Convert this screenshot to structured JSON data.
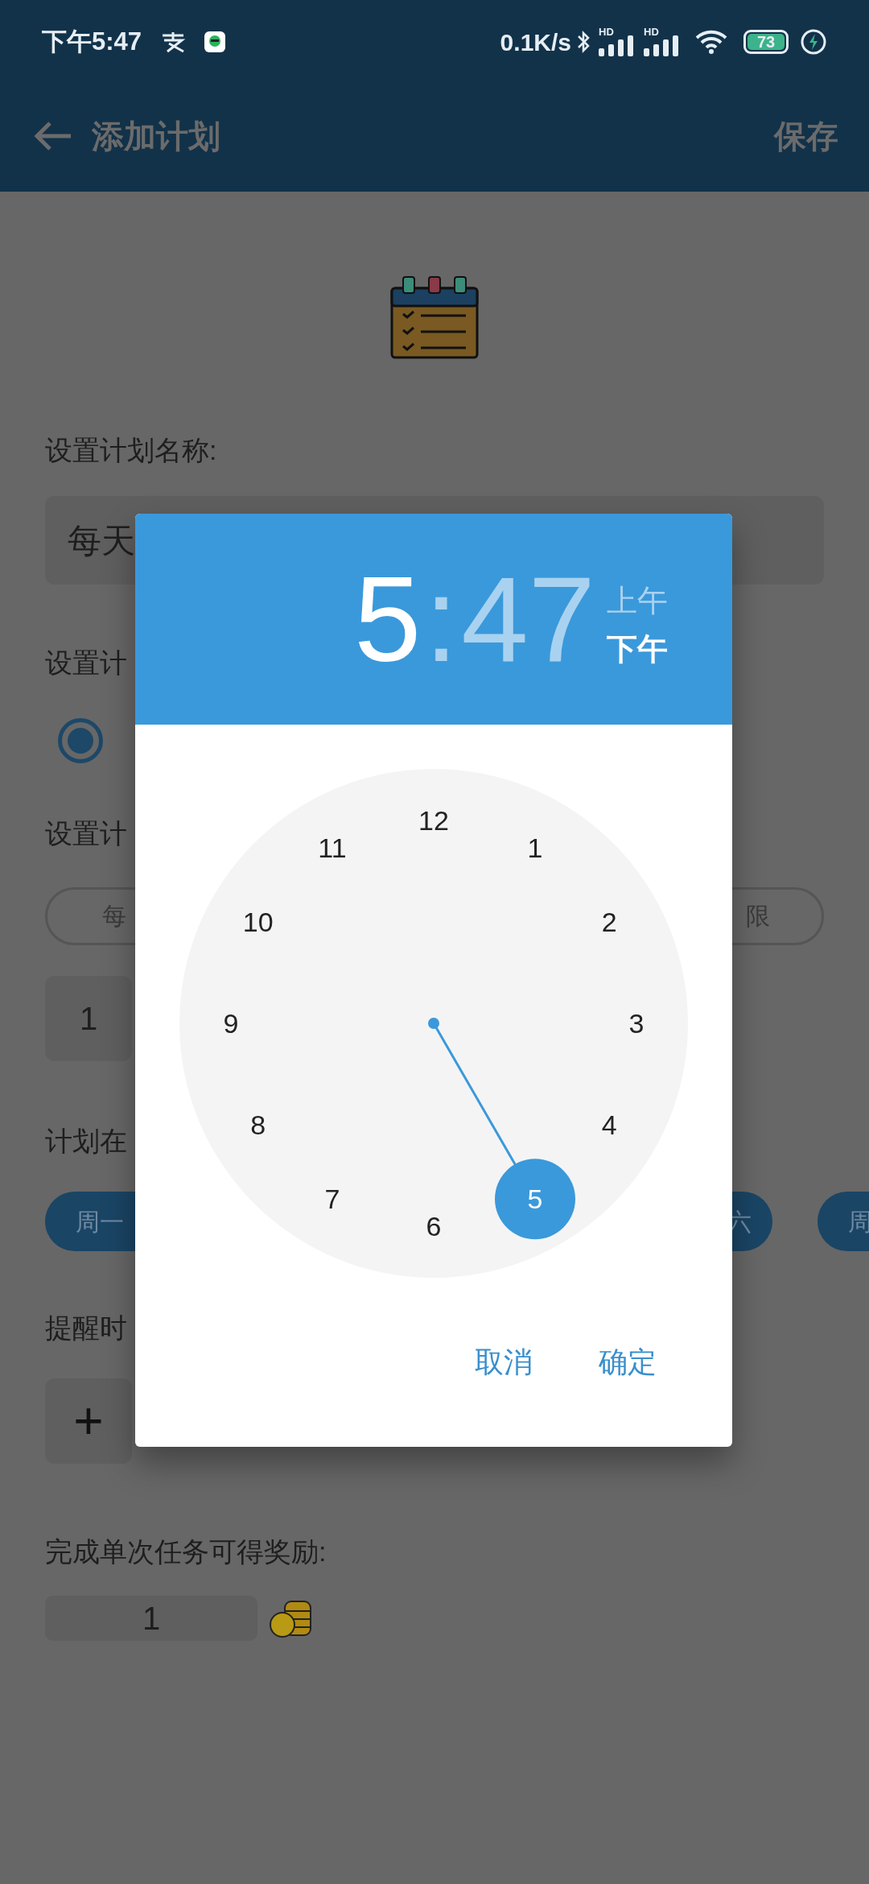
{
  "status_bar": {
    "time": "下午5:47",
    "net_speed": "0.1K/s",
    "signals": [
      {
        "label": "HD"
      },
      {
        "label": "HD"
      }
    ],
    "battery": "73"
  },
  "header": {
    "title": "添加计划",
    "action": "保存"
  },
  "form": {
    "name_label": "设置计划名称:",
    "name_value": "每天",
    "label_2": "设置计",
    "radio_selected": true,
    "label_3": "设置计",
    "period_chips": [
      {
        "label": "每"
      },
      {
        "label": "限"
      }
    ],
    "count_value": "1",
    "label_4": "计划在",
    "day_chips": [
      {
        "label": "周一"
      },
      {
        "label": "六"
      },
      {
        "label": "周"
      }
    ],
    "label_5": "提醒时",
    "add_button": "+",
    "reward_label": "完成单次任务可得奖励:",
    "reward_value": "1"
  },
  "dialog": {
    "hour": "5",
    "colon": ":",
    "minute": "47",
    "periods": [
      {
        "label": "上午",
        "selected": false
      },
      {
        "label": "下午",
        "selected": true
      }
    ],
    "numbers": [
      {
        "label": "12",
        "selected": false
      },
      {
        "label": "1",
        "selected": false
      },
      {
        "label": "2",
        "selected": false
      },
      {
        "label": "3",
        "selected": false
      },
      {
        "label": "4",
        "selected": false
      },
      {
        "label": "5",
        "selected": true
      },
      {
        "label": "6",
        "selected": false
      },
      {
        "label": "7",
        "selected": false
      },
      {
        "label": "8",
        "selected": false
      },
      {
        "label": "9",
        "selected": false
      },
      {
        "label": "10",
        "selected": false
      },
      {
        "label": "11",
        "selected": false
      }
    ],
    "buttons": [
      "取消",
      "确定"
    ]
  }
}
